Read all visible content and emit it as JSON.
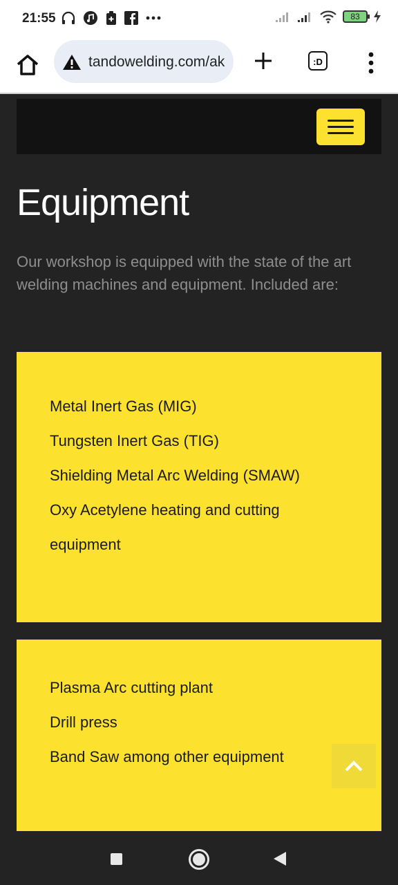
{
  "status_bar": {
    "time": "21:55",
    "battery": "83"
  },
  "browser": {
    "url": "tandowelding.com/ak",
    "tab_label": ":D"
  },
  "page": {
    "title": "Equipment",
    "intro": "Our workshop is equipped with the state of the art welding machines and equipment. Included are:",
    "card1_items": [
      "Metal Inert Gas (MIG)",
      "Tungsten Inert Gas (TIG)",
      "Shielding Metal Arc Welding (SMAW)",
      "Oxy Acetylene heating and cutting equipment"
    ],
    "card2_items": [
      "Plasma Arc cutting plant",
      "Drill press",
      "Band Saw among other equipment"
    ]
  },
  "colors": {
    "accent": "#fce22f",
    "background": "#232323",
    "header": "#121212"
  }
}
